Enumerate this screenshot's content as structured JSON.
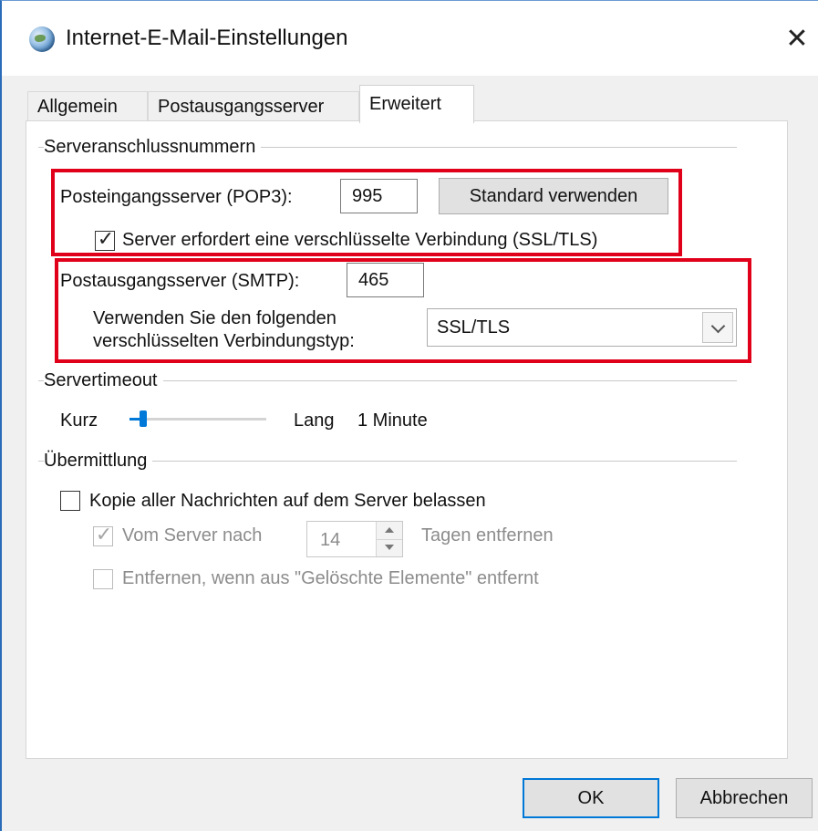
{
  "window": {
    "title": "Internet-E-Mail-Einstellungen"
  },
  "tabs": [
    {
      "label": "Allgemein"
    },
    {
      "label": "Postausgangsserver"
    },
    {
      "label": "Erweitert"
    }
  ],
  "server_ports": {
    "group_label": "Serveranschlussnummern",
    "pop3_label": "Posteingangsserver (POP3):",
    "pop3_value": "995",
    "default_button": "Standard verwenden",
    "ssl_checkbox_label": "Server erfordert eine verschlüsselte Verbindung (SSL/TLS)",
    "ssl_checked": true,
    "smtp_label": "Postausgangsserver (SMTP):",
    "smtp_value": "465",
    "encryption_label_line1": "Verwenden Sie den folgenden",
    "encryption_label_line2": "verschlüsselten Verbindungstyp:",
    "encryption_value": "SSL/TLS"
  },
  "timeout": {
    "group_label": "Servertimeout",
    "short_label": "Kurz",
    "long_label": "Lang",
    "value_text": "1 Minute",
    "slider_fraction": 0.1
  },
  "delivery": {
    "group_label": "Übermittlung",
    "keep_copy_label": "Kopie aller Nachrichten auf dem Server belassen",
    "keep_copy_checked": false,
    "remove_after_label": "Vom Server nach",
    "remove_after_checked": true,
    "days_value": "14",
    "days_suffix": "Tagen entfernen",
    "remove_deleted_label": "Entfernen, wenn aus \"Gelöschte Elemente\" entfernt",
    "remove_deleted_checked": false
  },
  "buttons": {
    "ok": "OK",
    "cancel": "Abbrechen"
  },
  "colors": {
    "highlight": "#e0001a",
    "accent": "#0078d7"
  }
}
